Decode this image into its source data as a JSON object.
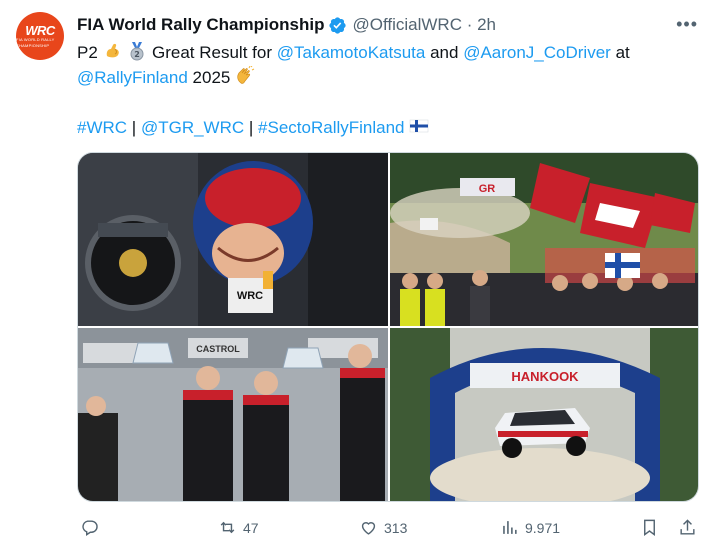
{
  "author": {
    "name": "FIA World Rally Championship",
    "handle": "@OfficialWRC",
    "time": "2h",
    "avatar_logo": "WRC",
    "avatar_sub": "FIA WORLD RALLY CHAMPIONSHIP",
    "verified_icon": "verified-badge-icon"
  },
  "tweet": {
    "text_p2": "P2",
    "text_great": "Great Result for",
    "mention_1": "@TakamotoKatsuta",
    "text_and": "and",
    "mention_2": "@AaronJ_CoDriver",
    "text_at": "at",
    "mention_3": "@RallyFinland",
    "text_year": "2025",
    "hashtag_1": "#WRC",
    "hashtag_2": "@TGR_WRC",
    "hashtag_3": "#SectoRallyFinland",
    "separator": "|"
  },
  "media": [
    {
      "name": "photo-driver-cockpit",
      "banner": "WRC"
    },
    {
      "name": "photo-spectators-flags",
      "banner": "GR"
    },
    {
      "name": "photo-podium-trophies",
      "banner": "CASTROL"
    },
    {
      "name": "photo-car-jump",
      "banner": "HANKOOK"
    }
  ],
  "actions": {
    "reply": {
      "icon": "reply-icon",
      "count": ""
    },
    "retweet": {
      "icon": "retweet-icon",
      "count": "47"
    },
    "like": {
      "icon": "heart-icon",
      "count": "313"
    },
    "views": {
      "icon": "views-icon",
      "count": "9.971"
    },
    "bookmark": {
      "icon": "bookmark-icon"
    },
    "share": {
      "icon": "share-icon"
    }
  },
  "colors": {
    "link": "#1d9bf0",
    "muted": "#536471",
    "verified": "#1d9bf0",
    "avatar_bg": "#e8461b"
  }
}
